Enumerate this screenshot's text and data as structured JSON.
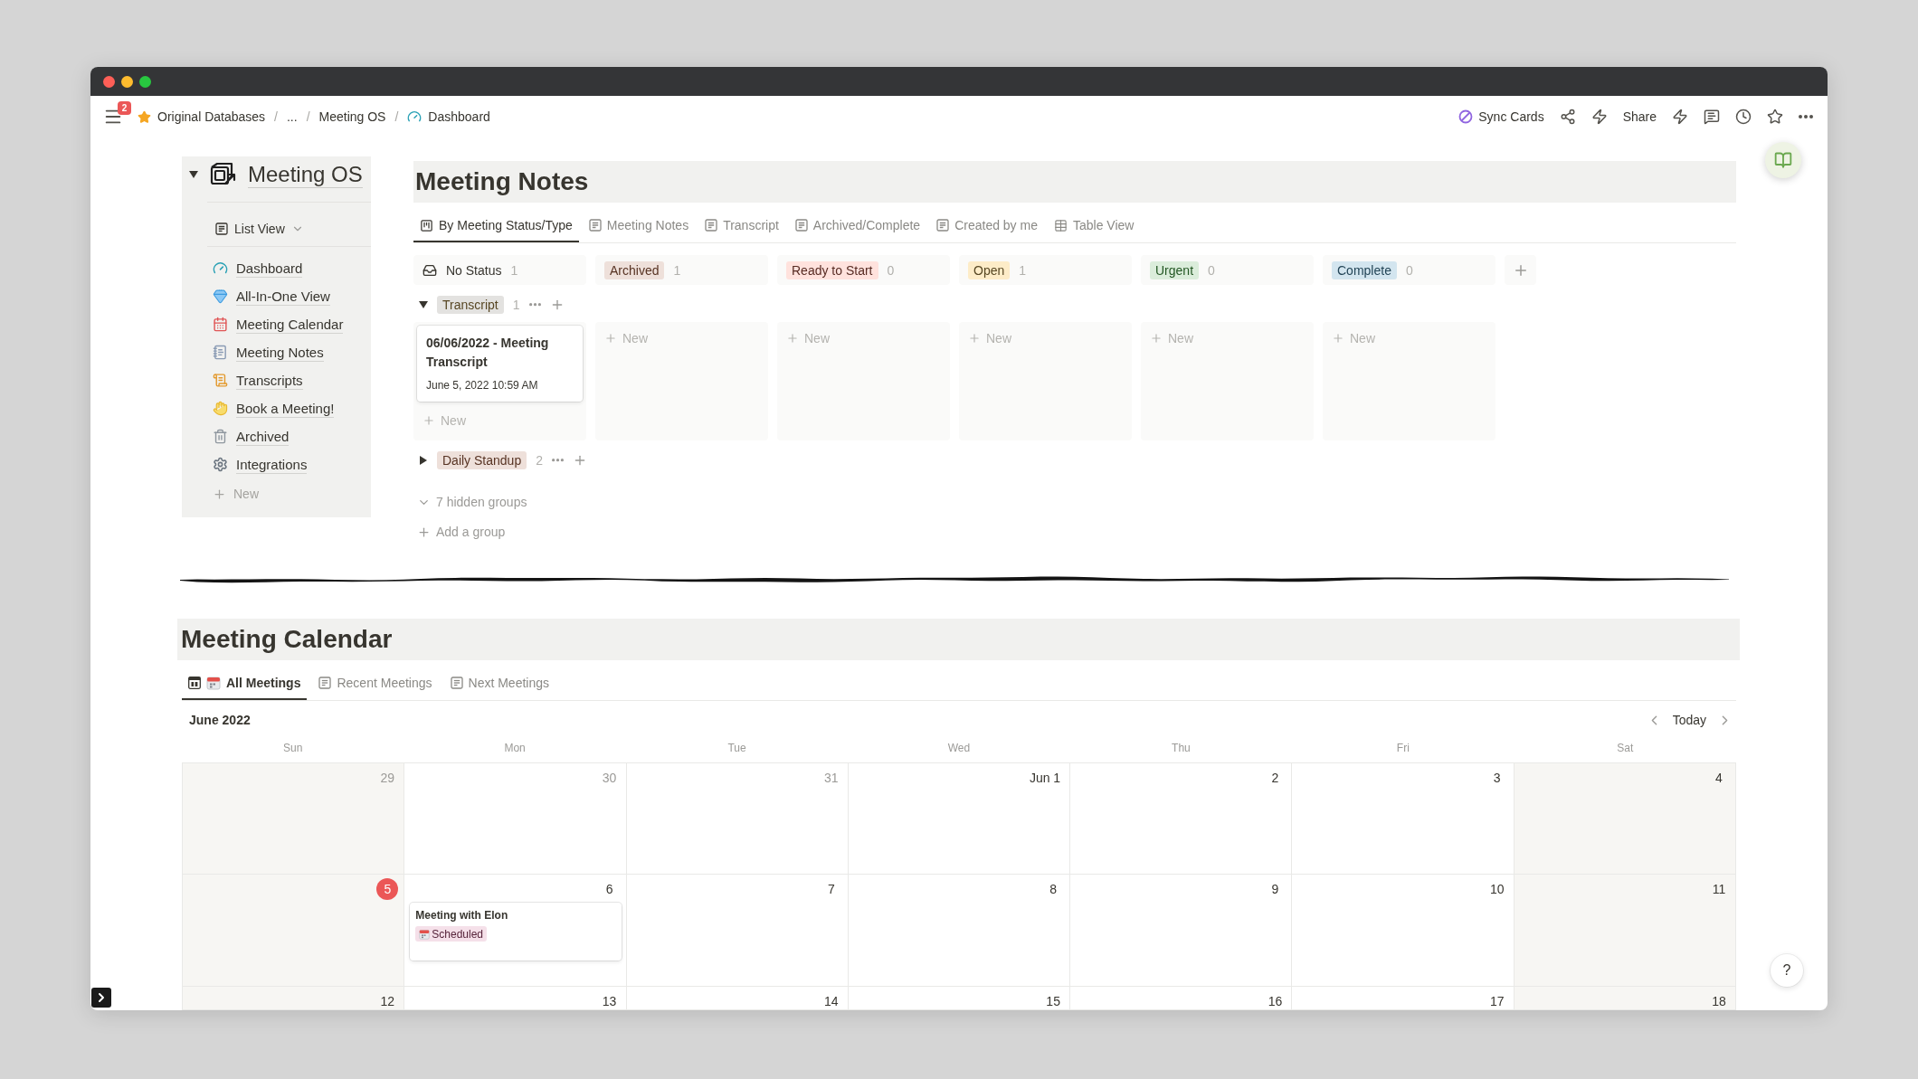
{
  "window": {
    "notification_count": "2",
    "breadcrumbs": [
      {
        "label": "Original Databases",
        "kind": "starred"
      },
      {
        "label": "...",
        "kind": "plain",
        "separator": "/"
      },
      {
        "label": "Meeting OS",
        "kind": "plain",
        "separator": "/"
      },
      {
        "label": "Dashboard",
        "kind": "current",
        "separator": "/"
      }
    ],
    "sync_label": "Sync Cards",
    "share_label": "Share",
    "help_label": "?"
  },
  "sidebar": {
    "title": "Meeting OS",
    "expanded": true,
    "view_label": "List View",
    "items": [
      {
        "label": "Dashboard"
      },
      {
        "label": "All-In-One View"
      },
      {
        "label": "Meeting Calendar"
      },
      {
        "label": "Meeting Notes"
      },
      {
        "label": "Transcripts"
      },
      {
        "label": "Book a Meeting!"
      },
      {
        "label": "Archived"
      },
      {
        "label": "Integrations"
      }
    ],
    "new_label": "New"
  },
  "meeting_notes": {
    "title": "Meeting Notes",
    "tabs": [
      {
        "label": "By Meeting Status/Type",
        "kind": "board",
        "selected": true
      },
      {
        "label": "Meeting Notes",
        "kind": "list",
        "selected": false
      },
      {
        "label": "Transcript",
        "kind": "list",
        "selected": false
      },
      {
        "label": "Archived/Complete",
        "kind": "list",
        "selected": false
      },
      {
        "label": "Created by me",
        "kind": "list",
        "selected": false
      },
      {
        "label": "Table View",
        "kind": "table",
        "selected": false
      }
    ],
    "columns": [
      {
        "label": "No Status",
        "count": "1",
        "kind": "empty"
      },
      {
        "label": "Archived",
        "count": "1",
        "kind": "tag",
        "color": "#eee0da"
      },
      {
        "label": "Ready to Start",
        "count": "0",
        "kind": "tag",
        "color": "#ffe2dd"
      },
      {
        "label": "Open",
        "count": "1",
        "kind": "tag",
        "color": "#fdecc8"
      },
      {
        "label": "Urgent",
        "count": "0",
        "kind": "tag",
        "color": "#dbeddb"
      },
      {
        "label": "Complete",
        "count": "0",
        "kind": "tag",
        "color": "#d3e5ef"
      }
    ],
    "groups": [
      {
        "label": "Transcript",
        "count": "1",
        "color": "#e3e2e0",
        "expanded": true,
        "cells": [
          {
            "cards": [
              {
                "title": "06/06/2022 - Meeting Transcript",
                "date": "June 5, 2022 10:59 AM"
              }
            ],
            "add_label": "New"
          },
          {
            "add_label": "New"
          },
          {
            "add_label": "New"
          },
          {
            "add_label": "New"
          },
          {
            "add_label": "New"
          },
          {
            "add_label": "New"
          }
        ]
      },
      {
        "label": "Daily Standup",
        "count": "2",
        "color": "#eee0da",
        "expanded": false
      }
    ],
    "hidden_groups": "7 hidden groups",
    "add_group": "Add a group"
  },
  "meeting_calendar": {
    "title": "Meeting Calendar",
    "tabs": [
      {
        "label": "All Meetings",
        "kind": "calendar",
        "selected": true
      },
      {
        "label": "Recent Meetings",
        "kind": "list",
        "selected": false
      },
      {
        "label": "Next Meetings",
        "kind": "list",
        "selected": false
      }
    ],
    "month": "June 2022",
    "today_label": "Today",
    "weekdays": [
      "Sun",
      "Mon",
      "Tue",
      "Wed",
      "Thu",
      "Fri",
      "Sat"
    ],
    "weeks": [
      [
        {
          "day": "29",
          "outside": true,
          "today": false
        },
        {
          "day": "30",
          "outside": true,
          "today": false
        },
        {
          "day": "31",
          "outside": true,
          "today": false
        },
        {
          "day": "Jun 1",
          "outside": false,
          "today": false
        },
        {
          "day": "2",
          "outside": false,
          "today": false
        },
        {
          "day": "3",
          "outside": false,
          "today": false
        },
        {
          "day": "4",
          "outside": false,
          "today": false
        }
      ],
      [
        {
          "day": "5",
          "outside": false,
          "today": true
        },
        {
          "day": "6",
          "outside": false,
          "today": false,
          "events": [
            {
              "title": "Meeting with Elon",
              "tag": {
                "label": "Scheduled",
                "color": "#f5e0e9"
              }
            }
          ]
        },
        {
          "day": "7",
          "outside": false,
          "today": false
        },
        {
          "day": "8",
          "outside": false,
          "today": false
        },
        {
          "day": "9",
          "outside": false,
          "today": false
        },
        {
          "day": "10",
          "outside": false,
          "today": false
        },
        {
          "day": "11",
          "outside": false,
          "today": false
        }
      ],
      [
        {
          "day": "12",
          "outside": false,
          "today": false
        },
        {
          "day": "13",
          "outside": false,
          "today": false
        },
        {
          "day": "14",
          "outside": false,
          "today": false
        },
        {
          "day": "15",
          "outside": false,
          "today": false
        },
        {
          "day": "16",
          "outside": false,
          "today": false
        },
        {
          "day": "17",
          "outside": false,
          "today": false
        },
        {
          "day": "18",
          "outside": false,
          "today": false
        }
      ]
    ]
  }
}
